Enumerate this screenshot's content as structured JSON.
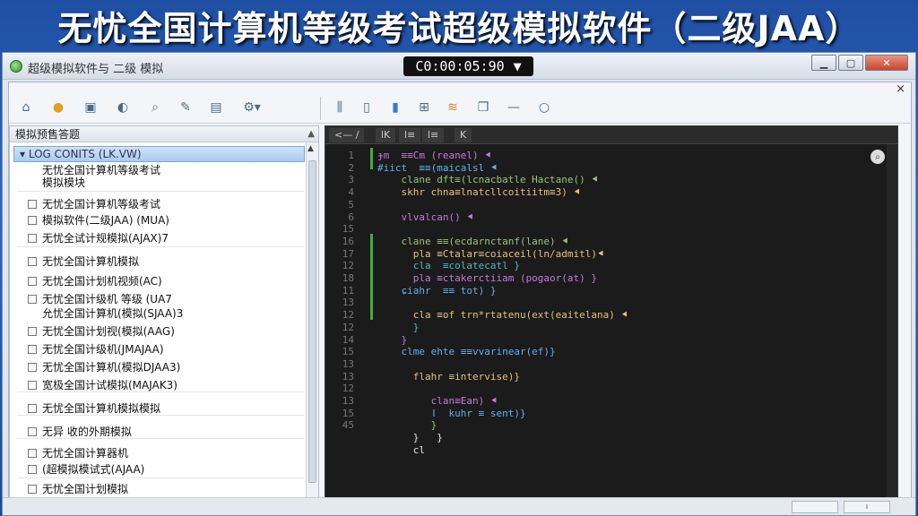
{
  "banner": {
    "title": "无忧全国计算机等级考试超级模拟软件（二级JAA）"
  },
  "window": {
    "title": "超级模拟软件与 二级 模拟",
    "timer": "C0:00:05:90",
    "timer_arrow": "▼",
    "minimize": "▁",
    "maximize": "▢",
    "close": "✕",
    "inner_close": "×"
  },
  "toolbar": {
    "icons": [
      "home-icon",
      "folder-icon",
      "save-icon",
      "shield-icon",
      "search-icon",
      "edit-icon",
      "document-icon",
      "settings-icon",
      "list-icon",
      "file-icon",
      "chart-icon",
      "grid-icon",
      "stack-icon",
      "copy-icon",
      "minus-icon",
      "magnifier-icon"
    ]
  },
  "left_panel": {
    "header": "模拟预售答题",
    "header_arrow": "▲",
    "selected": "▾ LOG CONITS (LK.VW)",
    "items": [
      {
        "text": "无忧全国计算机等级考试",
        "checkbox": false
      },
      {
        "text": "模拟模块",
        "checkbox": false
      },
      {
        "text": "无忧全国计算机等级考试",
        "checkbox": true
      },
      {
        "text": "模拟软件(二级JAA) (MUA)",
        "checkbox": true
      },
      {
        "text": "无忧全试计规模拟(AJAX)7",
        "checkbox": true
      },
      {
        "text": "无忧全国计算机模拟",
        "checkbox": true
      },
      {
        "text": "无忧全国计划机视频(AC)",
        "checkbox": true
      },
      {
        "text": "无忧全国计级机 等级 (UA7",
        "checkbox": true
      },
      {
        "text": "允忧全国计算机(模拟(SJAA)3",
        "checkbox": false
      },
      {
        "text": "无忧全国计划视(模拟(AAG)",
        "checkbox": true
      },
      {
        "text": "无忧全国计级机(JMAJAA)",
        "checkbox": true
      },
      {
        "text": "无忧全国计算机(模拟DJAA3)",
        "checkbox": true
      },
      {
        "text": "宽极全国计试模拟(MAJAK3)",
        "checkbox": true
      },
      {
        "text": "无忧全国计算机模拟模拟",
        "checkbox": true
      },
      {
        "text": "无异 收的外期模拟",
        "checkbox": true
      },
      {
        "text": "无忧全国计算器机",
        "checkbox": true
      },
      {
        "text": "(超模拟模试式(AJAA)",
        "checkbox": true
      },
      {
        "text": "无忧全国计划模拟",
        "checkbox": true
      }
    ]
  },
  "editor": {
    "tabs": [
      "<— /",
      "lK",
      "l≡",
      "l≡",
      "K"
    ],
    "line_numbers": [
      "1",
      "2",
      "3",
      "4",
      "5",
      "6",
      "15",
      "16",
      "17",
      "12",
      "18",
      "11",
      "13",
      "12",
      "12",
      "14",
      "15",
      "13",
      "13",
      "12",
      "13",
      "15",
      "45"
    ],
    "lines": [
      "ɟm  ≡≡Cm (reanel) ⯇",
      "#iict  ≡≡(maicalsl ⯇",
      "    clane dft≡(lcnacbatle Hactane() ⯇",
      "    skhr chna≡lnatcllcoitiitm≡3) ⯇",
      "",
      "    vlvalcan() ⯇",
      "",
      "    clane ≡≡(ecdarnctanf(lane) ⯇",
      "      pla ≡Ctalar≡coiaceil(ln/admitl)⯇",
      "      cla  ≡colatecatl }",
      "      pla ≡ctakerctiiam (pogaor(at) }",
      "    ɕiahr  ≡≡ tot) }",
      "",
      "      cla ≡of trn*rtatenu(ext(eaitelana) ⯇",
      "      }",
      "    }",
      "    clme ehte ≡≡vvarinear(ef)}",
      "",
      "      flahr ≡intervise)}",
      "",
      "         clan≡Ean) ⯇",
      "         ǀ  kuhr ≡ sent)}",
      "         }"
    ],
    "trailing": [
      "      }   }",
      "      cl"
    ]
  }
}
